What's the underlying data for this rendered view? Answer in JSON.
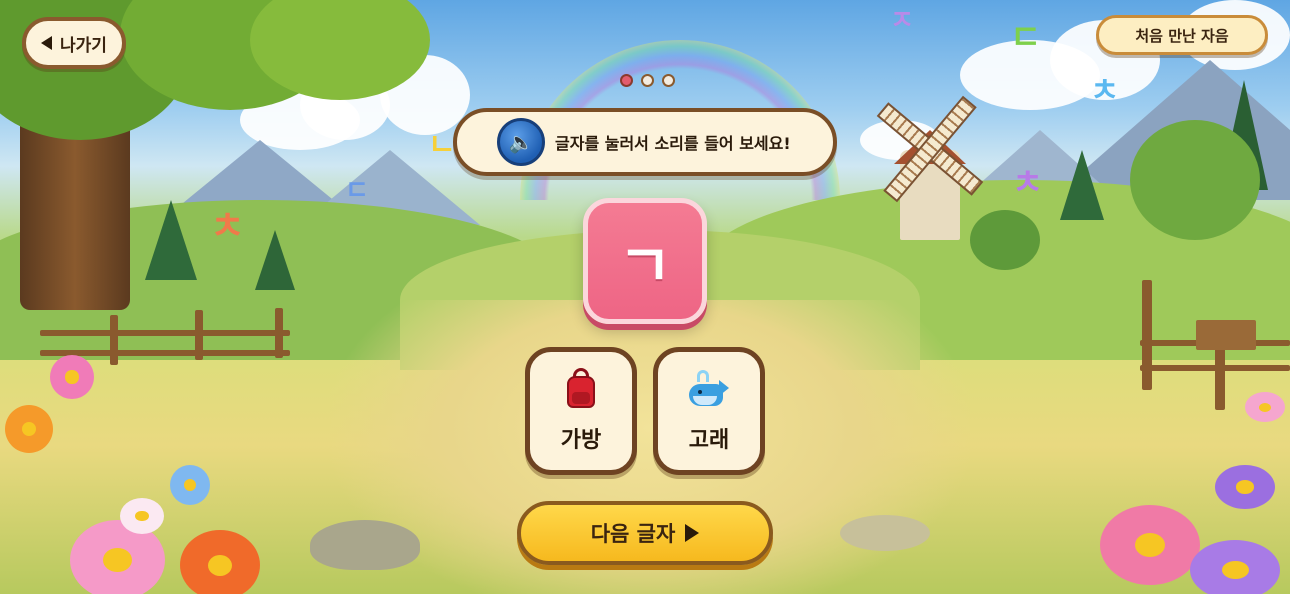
{
  "header": {
    "back_label": "나가기",
    "stage_label": "처음 만난 자음"
  },
  "progress": {
    "total_pages": 3,
    "current_page": 1
  },
  "instruction": {
    "text": "글자를 눌러서 소리를 들어 보세요!",
    "speaker_icon": "speaker-icon"
  },
  "letter": {
    "char": "ㄱ",
    "color": "#ee6585"
  },
  "words": [
    {
      "label": "가방",
      "icon": "backpack-icon"
    },
    {
      "label": "고래",
      "icon": "whale-icon"
    }
  ],
  "next": {
    "label": "다음 글자",
    "icon": "play-icon"
  },
  "colors": {
    "frame_brown": "#7a4e26",
    "card_cream": "#fdf3dc",
    "next_yellow": "#f6b91e",
    "dot_active": "#e25c6e"
  }
}
